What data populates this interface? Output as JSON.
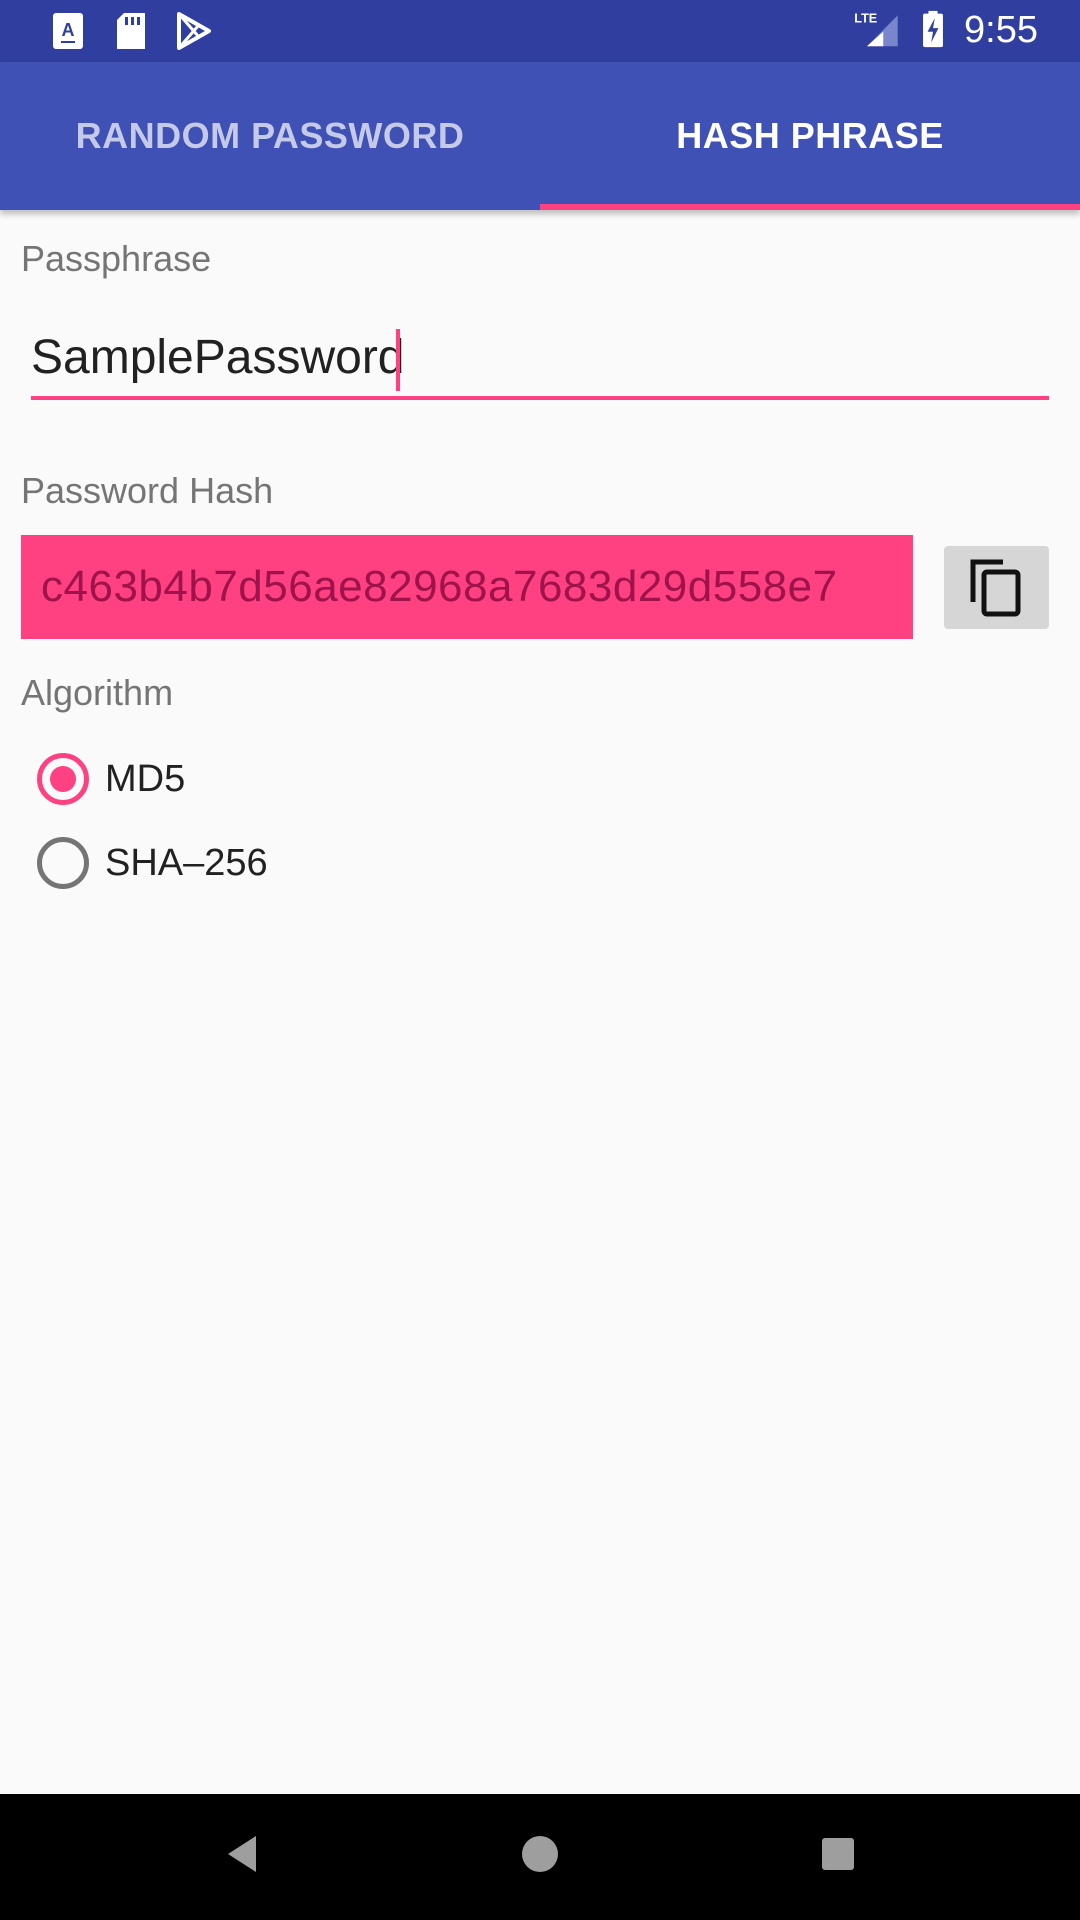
{
  "status_bar": {
    "time": "9:55",
    "network_label": "LTE",
    "icons": [
      "app-store-notification-icon",
      "sd-card-icon",
      "play-store-icon",
      "lte-signal-icon",
      "battery-charging-icon"
    ]
  },
  "tabs": [
    {
      "label": "RANDOM PASSWORD",
      "selected": false
    },
    {
      "label": "HASH PHRASE",
      "selected": true
    }
  ],
  "passphrase": {
    "label": "Passphrase",
    "value": "SamplePassword"
  },
  "password_hash": {
    "label": "Password Hash",
    "value": "c463b4b7d56ae82968a7683d29d558e7"
  },
  "copy_button": {
    "icon": "copy-icon"
  },
  "algorithm": {
    "label": "Algorithm",
    "options": [
      {
        "label": "MD5",
        "checked": true
      },
      {
        "label": "SHA–256",
        "checked": false
      }
    ]
  },
  "nav_bar": {
    "buttons": [
      "back-icon",
      "home-icon",
      "recents-icon"
    ]
  },
  "colors": {
    "primary": "#3f51b5",
    "primary_dark": "#303f9f",
    "accent": "#ff4081"
  }
}
